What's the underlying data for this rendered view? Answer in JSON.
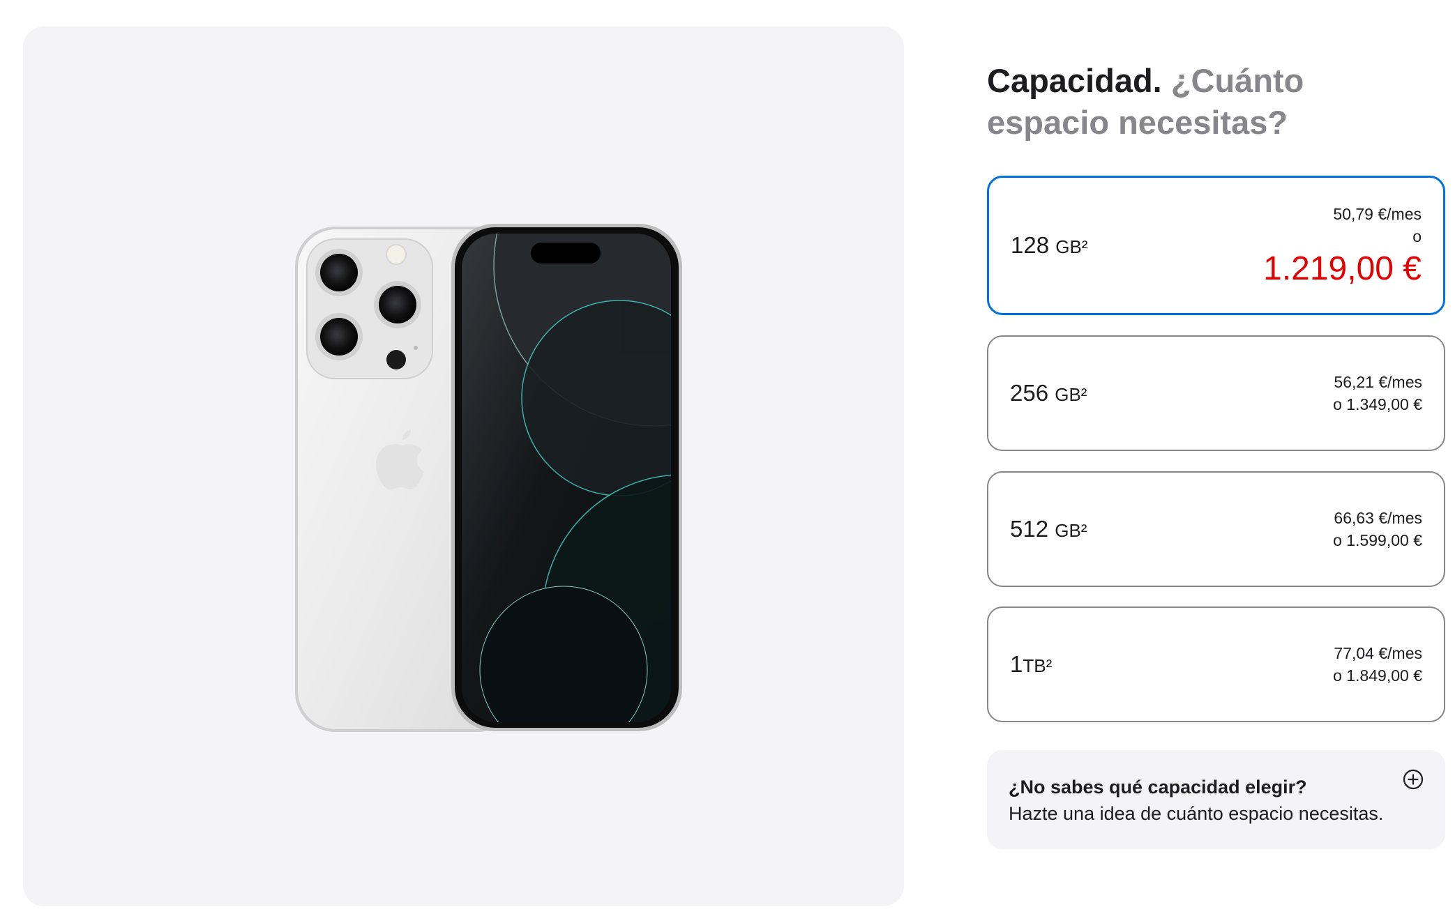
{
  "gallery": {
    "image_alt": "iPhone Pro blanco"
  },
  "heading": {
    "strong": "Capacidad.",
    "muted": "¿Cuánto espacio necesitas?"
  },
  "options": [
    {
      "capacity": "128",
      "unit": "GB²",
      "monthly": "50,79 €/mes",
      "or": "o",
      "price": "1.219,00 €",
      "selected": true
    },
    {
      "capacity": "256",
      "unit": "GB²",
      "monthly": "56,21 €/mes",
      "price_line": "o 1.349,00 €",
      "selected": false
    },
    {
      "capacity": "512",
      "unit": "GB²",
      "monthly": "66,63 €/mes",
      "price_line": "o 1.599,00 €",
      "selected": false
    },
    {
      "capacity": "1",
      "unit": "TB²",
      "monthly": "77,04 €/mes",
      "price_line": "o 1.849,00 €",
      "selected": false
    }
  ],
  "help": {
    "question": "¿No sabes qué capacidad elegir?",
    "answer": "Hazte una idea de cuánto espacio necesitas.",
    "icon": "plus-circle-icon"
  },
  "colors": {
    "selected_border": "#0071e3",
    "price_red": "#e30000",
    "muted_text": "#86868b",
    "panel_bg": "#f4f4f6"
  }
}
